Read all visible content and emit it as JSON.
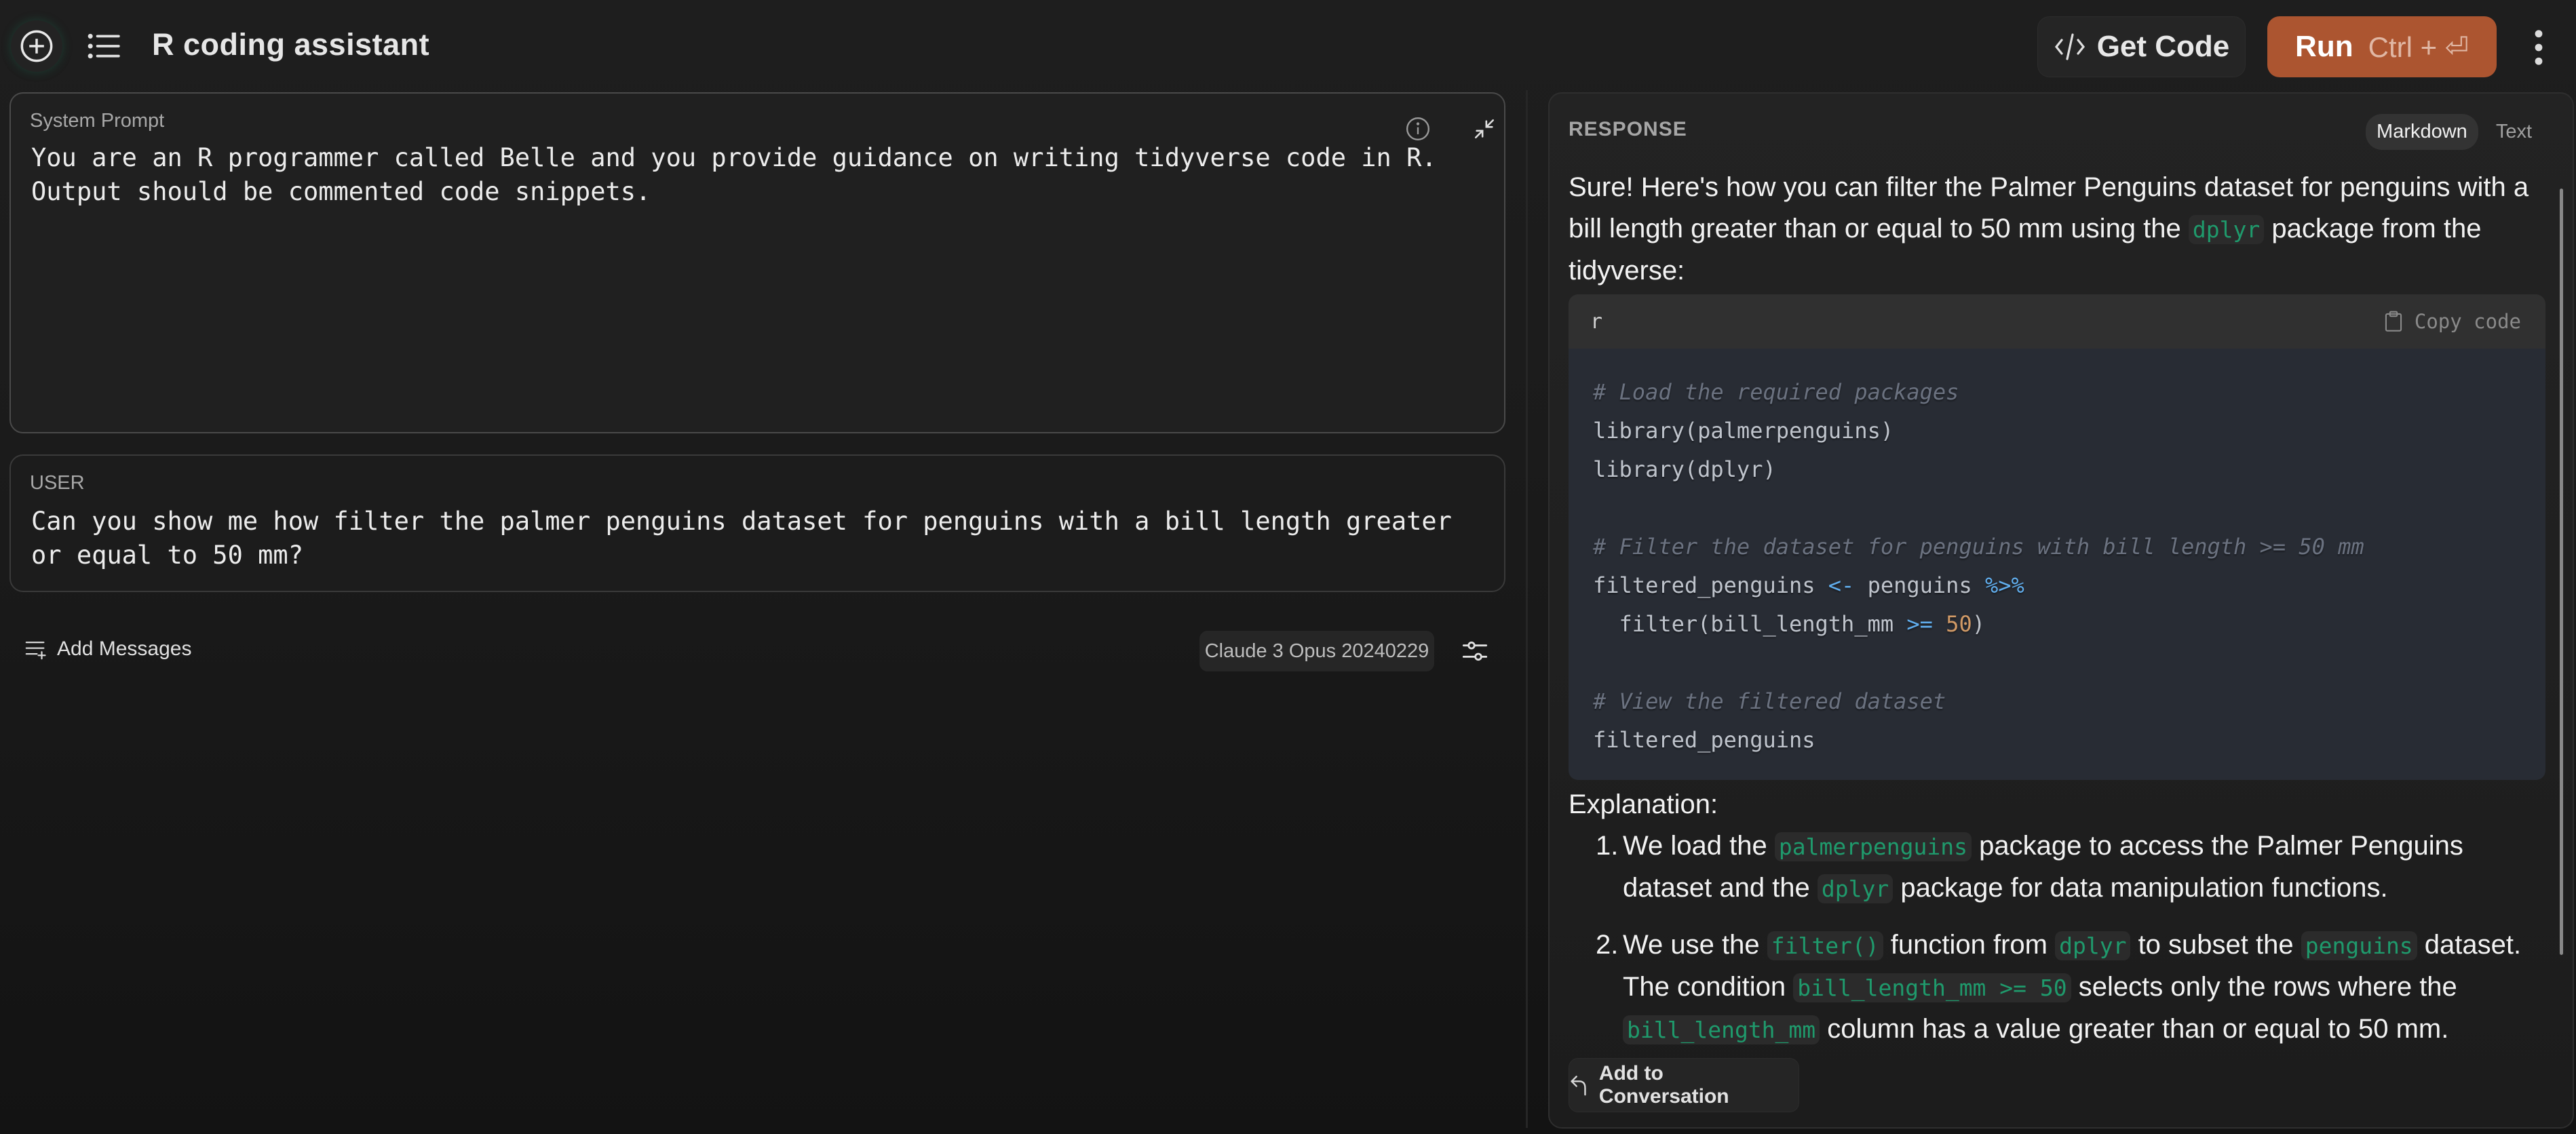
{
  "header": {
    "title": "R coding assistant",
    "new_icon": "plus-circle-icon",
    "list_icon": "list-icon",
    "get_code_label": "Get Code",
    "get_code_icon": "code-icon",
    "run_label": "Run",
    "run_shortcut": "Ctrl + ⏎",
    "more_icon": "more-vertical-icon"
  },
  "system_prompt": {
    "label": "System Prompt",
    "text": "You are an R programmer called Belle and you provide guidance on writing tidyverse code in R. Output should be commented code snippets.",
    "info_icon": "info-icon",
    "collapse_icon": "collapse-icon"
  },
  "user_message": {
    "label": "USER",
    "text": "Can you show me how filter the palmer penguins dataset for penguins with a bill length greater or equal to 50 mm?"
  },
  "footer_left": {
    "add_messages_label": "Add Messages",
    "model": "Claude 3 Opus 20240229",
    "settings_icon": "sliders-icon"
  },
  "response": {
    "title": "RESPONSE",
    "toggle": [
      "Markdown",
      "Text"
    ],
    "active_view": "Markdown",
    "intro": {
      "part1": "Sure! Here's how you can filter the Palmer Penguins dataset for penguins with a bill length greater than or equal to 50 mm using the",
      "code": "dplyr",
      "part2": "package from the tidyverse:"
    },
    "code_block": {
      "language": "r",
      "copy_label": "Copy code",
      "lines": {
        "l1": "# Load the required packages",
        "l2": "library(palmerpenguins)",
        "l3": "library(dplyr)",
        "l5": "# Filter the dataset for penguins with bill length >= 50 mm",
        "l6a": "filtered_penguins ",
        "l6b": "<-",
        "l6c": " penguins ",
        "l6d": "%>%",
        "l7a": "  filter(bill_length_mm ",
        "l7b": ">=",
        "l7c": " ",
        "l7d": "50",
        "l7e": ")",
        "l9": "# View the filtered dataset",
        "l10": "filtered_penguins"
      }
    },
    "explanation_title": "Explanation:",
    "explanation": [
      {
        "num": "1.",
        "t1": "We load the ",
        "c1": "palmerpenguins",
        "t2": " package to access the Palmer Penguins dataset and the ",
        "c2": "dplyr",
        "t3": " package for data manipulation functions."
      },
      {
        "num": "2.",
        "t1": "We use the ",
        "c1": "filter()",
        "t2": " function from ",
        "c2": "dplyr",
        "t3": " to subset the ",
        "c3": "penguins",
        "t4": " dataset. The condition ",
        "c4": "bill_length_mm >= 50",
        "t5": " selects only the rows where the ",
        "c5": "bill_length_mm",
        "t6": " column has a value greater than or equal to 50 mm."
      }
    ],
    "add_to_conversation_label": "Add to Conversation"
  },
  "colors": {
    "accent_run": "#ac5530",
    "inline_code": "#1f9a6c",
    "code_bg": "#282c34"
  }
}
